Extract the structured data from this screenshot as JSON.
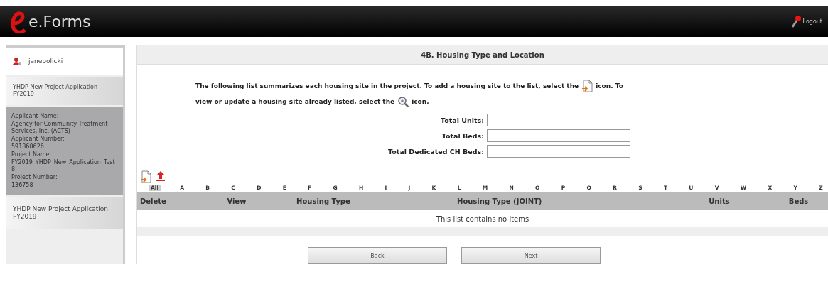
{
  "header": {
    "logo_text": "e.Forms",
    "logout": "Logout"
  },
  "sidebar": {
    "user": "janebolicki",
    "nav_top": "YHDP New Project Application FY2019",
    "info": [
      {
        "label": "Applicant Name:",
        "value": "Agency for Community Treatment Services, Inc. (ACTS)"
      },
      {
        "label": "Applicant Number:",
        "value": "591860626"
      },
      {
        "label": "Project Name:",
        "value": "FY2019_YHDP_New_Application_Test8"
      },
      {
        "label": "Project Number:",
        "value": "136758"
      }
    ],
    "nav_bottom": "YHDP New Project Application FY2019"
  },
  "main": {
    "title": "4B. Housing Type and Location",
    "instructions": [
      "The following list summarizes each housing site in the project. To add a housing site to the list, select the",
      "icon. To",
      "view or update a housing site already listed, select the",
      "icon."
    ],
    "fields": [
      {
        "label": "Total Units:"
      },
      {
        "label": "Total Beds:"
      },
      {
        "label": "Total Dedicated CH Beds:"
      }
    ],
    "letters": [
      {
        "label": "All",
        "selected": true
      },
      {
        "label": "A",
        "selected": false
      },
      {
        "label": "B",
        "selected": false
      },
      {
        "label": "C",
        "selected": false
      },
      {
        "label": "D",
        "selected": false
      },
      {
        "label": "E",
        "selected": false
      },
      {
        "label": "F",
        "selected": false
      },
      {
        "label": "G",
        "selected": false
      },
      {
        "label": "H",
        "selected": false
      },
      {
        "label": "I",
        "selected": false
      },
      {
        "label": "J",
        "selected": false
      },
      {
        "label": "K",
        "selected": false
      },
      {
        "label": "L",
        "selected": false
      },
      {
        "label": "M",
        "selected": false
      },
      {
        "label": "N",
        "selected": false
      },
      {
        "label": "O",
        "selected": false
      },
      {
        "label": "P",
        "selected": false
      },
      {
        "label": "Q",
        "selected": false
      },
      {
        "label": "R",
        "selected": false
      },
      {
        "label": "S",
        "selected": false
      },
      {
        "label": "T",
        "selected": false
      },
      {
        "label": "U",
        "selected": false
      },
      {
        "label": "V",
        "selected": false
      },
      {
        "label": "W",
        "selected": false
      },
      {
        "label": "X",
        "selected": false
      },
      {
        "label": "Y",
        "selected": false
      },
      {
        "label": "Z",
        "selected": false
      }
    ],
    "table": {
      "columns": [
        "Delete",
        "View",
        "Housing Type",
        "Housing Type (JOINT)",
        "Units",
        "Beds"
      ],
      "empty_message": "This list contains no items"
    },
    "buttons": [
      "Back",
      "Next"
    ]
  }
}
